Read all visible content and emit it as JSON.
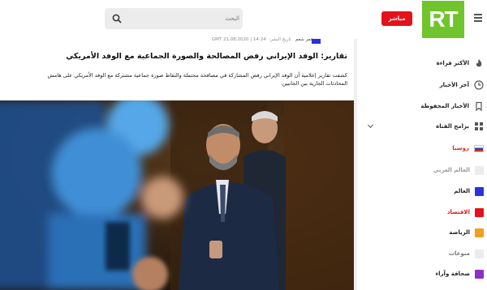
{
  "header": {
    "logo_text": "RT",
    "live_label": "مباشر",
    "search_placeholder": "البحث",
    "colors": {
      "logo": "#6fc52b",
      "live": "#e3121b"
    }
  },
  "sidebar": {
    "items": [
      {
        "label": "الأكثر قراءة",
        "icon": "fire-icon"
      },
      {
        "label": "آخر الأخبار",
        "icon": "clock-icon"
      },
      {
        "label": "الأخبار المحفوظة",
        "icon": "bookmark-icon"
      },
      {
        "label": "برامج القناة",
        "icon": "grid-icon"
      },
      {
        "label": "روسيا",
        "icon": "russia-flag-icon",
        "color": "#d52b1e"
      },
      {
        "label": "العالم العربي",
        "icon": "square-icon",
        "color": "#ececec"
      },
      {
        "label": "العالم",
        "icon": "square-icon",
        "color": "#2b2fe0"
      },
      {
        "label": "الاقتصاد",
        "icon": "square-icon",
        "color": "#e3121b"
      },
      {
        "label": "الرياضة",
        "icon": "square-icon",
        "color": "#f0a020"
      },
      {
        "label": "منوعات",
        "icon": "square-icon",
        "color": "#ececec"
      },
      {
        "label": "صحافة وآراء",
        "icon": "square-icon",
        "color": "#8e2fcc"
      }
    ]
  },
  "article": {
    "author": "عمر شعم",
    "date_label": "تاريخ النشر:",
    "datetime": "14:24 | 21.08.2020 GMT",
    "headline": "تقارير: الوفد الإيراني رفض المصالحة والصورة الجماعية مع الوفد الأمريكي",
    "lead": "كشفت تقارير إعلامية أن الوفد الإيراني رفض المشاركة في مصافحة محتملة والتقاط صورة جماعية مشتركة مع الوفد الأمريكي على هامش المحادثات الجارية بين الجانبين."
  }
}
